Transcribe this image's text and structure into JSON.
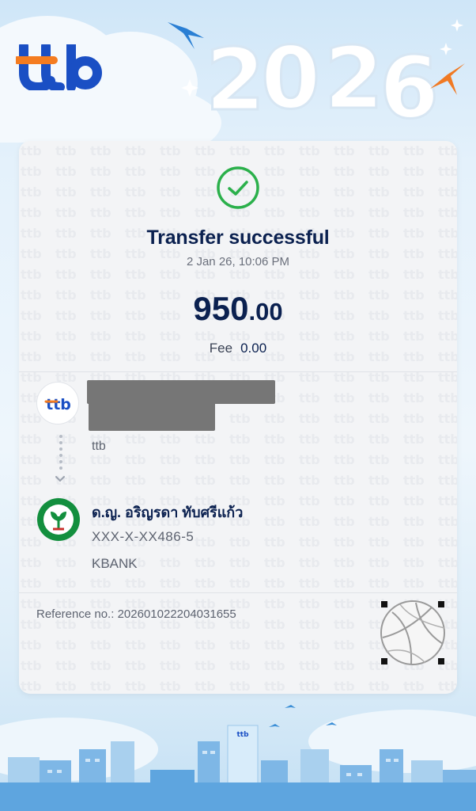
{
  "brand": {
    "logo_text": "ttb",
    "campaign_year": "2026"
  },
  "transfer": {
    "status_title": "Transfer successful",
    "datetime": "2 Jan 26, 10:06 PM",
    "amount_integer": "950",
    "amount_decimal": ".00",
    "fee_label": "Fee",
    "fee_value": "0.00"
  },
  "sender": {
    "bank_logo_text": "ttb",
    "bank_name": "ttb",
    "name_redacted": true
  },
  "receiver": {
    "name": "ด.ญ. อริญรดา ทับศรีแก้ว",
    "account": "XXX-X-XX486-5",
    "bank_name": "KBANK"
  },
  "reference": {
    "label": "Reference no.:",
    "value": "202601022204031655"
  },
  "footer": {
    "building_sign": "ttb"
  },
  "colors": {
    "navy": "#0b2150",
    "ttb_blue": "#1a4fc4",
    "ttb_orange": "#f47c20",
    "success_green": "#2bb04b",
    "kbank_green": "#138f3e"
  },
  "icons": [
    "check-circle-icon",
    "chevron-down-icon",
    "volleyball-sticker",
    "bird-icon"
  ]
}
